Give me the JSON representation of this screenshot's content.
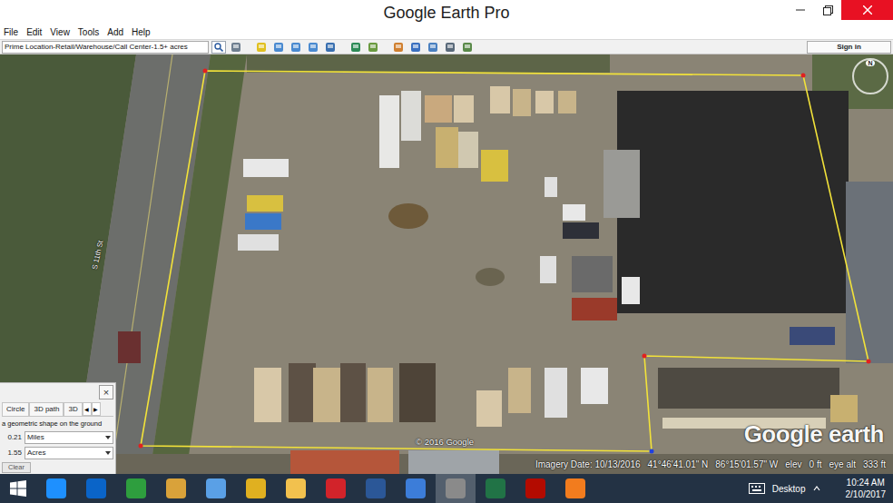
{
  "window": {
    "title": "Google Earth Pro"
  },
  "menu": [
    "File",
    "Edit",
    "View",
    "Tools",
    "Add",
    "Help"
  ],
  "toolbar": {
    "search": "Prime Location-Retail/Warehouse/Call Center-1.5+ acres",
    "sign_in": "Sign in"
  },
  "map": {
    "road_label": "S 11th St",
    "copyright": "© 2016 Google",
    "logo": "Google earth",
    "compass": "N"
  },
  "status_bar": {
    "imagery_date": "Imagery Date: 10/13/2016",
    "lat": "41°46'41.01\" N",
    "lon": "86°15'01.57\" W",
    "elev_label": "elev",
    "elev": "0 ft",
    "eye_alt_label": "eye alt",
    "eye_alt": "333 ft"
  },
  "ruler": {
    "close": "×",
    "tabs": [
      {
        "label": "Circle",
        "selected": false
      },
      {
        "label": "3D path",
        "selected": false
      },
      {
        "label": "3D",
        "selected": false
      }
    ],
    "arrows": [
      "◀",
      "▶"
    ],
    "hint": "a geometric shape on the ground",
    "measures": [
      {
        "value": "0.21",
        "unit": "Miles"
      },
      {
        "value": "1.55",
        "unit": "Acres"
      }
    ],
    "button": "Clear"
  },
  "taskbar": {
    "apps": [
      {
        "kind": "start",
        "color": "#ffffff",
        "selected": false
      },
      {
        "kind": "app",
        "color": "#1e90ff",
        "selected": false
      },
      {
        "kind": "app",
        "color": "#0a64c8",
        "selected": false
      },
      {
        "kind": "app",
        "color": "#2e9e3e",
        "selected": false
      },
      {
        "kind": "app",
        "color": "#d9a23a",
        "selected": false
      },
      {
        "kind": "app",
        "color": "#5aa0e6",
        "selected": false
      },
      {
        "kind": "app",
        "color": "#e0b020",
        "selected": false
      },
      {
        "kind": "app",
        "color": "#f2c14e",
        "selected": false
      },
      {
        "kind": "app",
        "color": "#d2232a",
        "selected": false
      },
      {
        "kind": "app",
        "color": "#2b5797",
        "selected": false
      },
      {
        "kind": "app",
        "color": "#3c7dd9",
        "selected": false
      },
      {
        "kind": "app",
        "color": "#8a8a8a",
        "selected": true
      },
      {
        "kind": "app",
        "color": "#217346",
        "selected": false
      },
      {
        "kind": "app",
        "color": "#b30b00",
        "selected": false
      },
      {
        "kind": "app",
        "color": "#f27c1e",
        "selected": false
      }
    ],
    "desktop": "Desktop",
    "time": "10:24 AM",
    "date": "2/10/2017"
  }
}
